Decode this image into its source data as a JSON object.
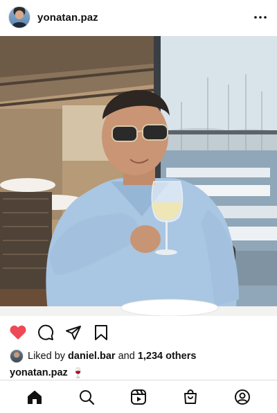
{
  "post": {
    "username": "yonatan.paz",
    "likes": {
      "prefix": "Liked by",
      "first_liker": "daniel.bar",
      "connector": "and",
      "others": "1,234 others"
    },
    "caption": {
      "username": "yonatan.paz",
      "text": "🍷"
    }
  },
  "icons": {
    "header_more": "more-horizontal-icon",
    "like": "heart-filled-icon",
    "comment": "comment-icon",
    "share": "send-icon",
    "save": "bookmark-icon",
    "nav": [
      "home-icon",
      "search-icon",
      "reels-icon",
      "shop-icon",
      "profile-icon"
    ]
  },
  "colors": {
    "like_red": "#ED4956",
    "text": "#111111",
    "divider": "#DBDBDB"
  }
}
